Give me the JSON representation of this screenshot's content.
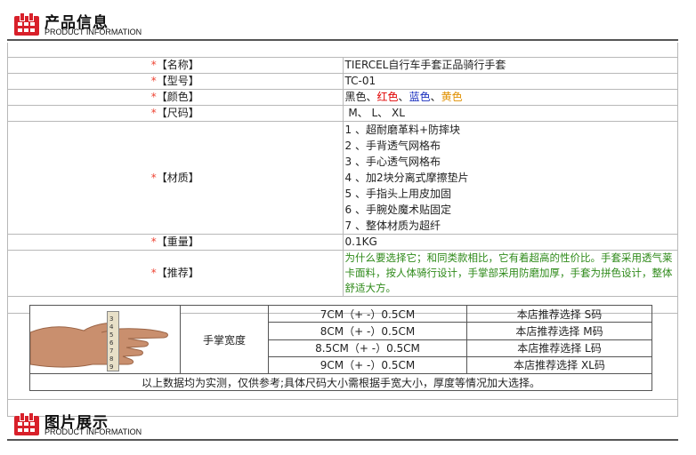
{
  "header_top": {
    "title": "产品信息",
    "subtitle": "PRODUCT INFORMATION"
  },
  "info": {
    "star": "*",
    "name_label": "【名称】",
    "name_value": "TIERCEL自行车手套正品骑行手套",
    "model_label": "【型号】",
    "model_value": "TC-01",
    "color_label": "【颜色】",
    "colors": [
      {
        "text": "黑色",
        "color": "#222222"
      },
      {
        "text": "红色",
        "color": "#e00000"
      },
      {
        "text": "蓝色",
        "color": "#1a2fbf"
      },
      {
        "text": "黄色",
        "color": "#e09000"
      }
    ],
    "color_sep": "、",
    "size_label": "【尺码】",
    "size_value": " M、 L、 XL",
    "material_label": "【材质】",
    "materials": [
      "1 、超耐磨革料+防摔块",
      "2 、手背透气网格布",
      "3 、手心透气网格布",
      "4 、加2块分离式摩擦垫片",
      "5 、手指头上用皮加固",
      "6 、手腕处魔术贴固定",
      "7 、整体材质为超纤"
    ],
    "weight_label": "【重量】",
    "weight_value": "0.1KG",
    "recommend_label": "【推荐】",
    "recommend_value": "为什么要选择它；和同类款相比，它有着超高的性价比。手套采用透气莱卡面料，按人体骑行设计，手掌部采用防磨加厚，手套为拼色设计，整体舒适大方。"
  },
  "size_table": {
    "palm_label": "手掌宽度",
    "rows": [
      {
        "range": "7CM（+ -）0.5CM",
        "rec": "本店推荐选择 S码"
      },
      {
        "range": "8CM（+ -）0.5CM",
        "rec": "本店推荐选择 M码"
      },
      {
        "range": "8.5CM（+ -）0.5CM",
        "rec": "本店推荐选择 L码"
      },
      {
        "range": "9CM（+ -）0.5CM",
        "rec": "本店推荐选择 XL码"
      }
    ],
    "note": "以上数据均为实测，仅供参考;具体尺码大小需根据手宽大小，厚度等情况加大选择。",
    "ruler_digits": [
      "3",
      "4",
      "5",
      "6",
      "7",
      "8",
      "9"
    ]
  },
  "header_bottom": {
    "title": "图片展示",
    "subtitle": "PRODUCT INFORMATION"
  }
}
